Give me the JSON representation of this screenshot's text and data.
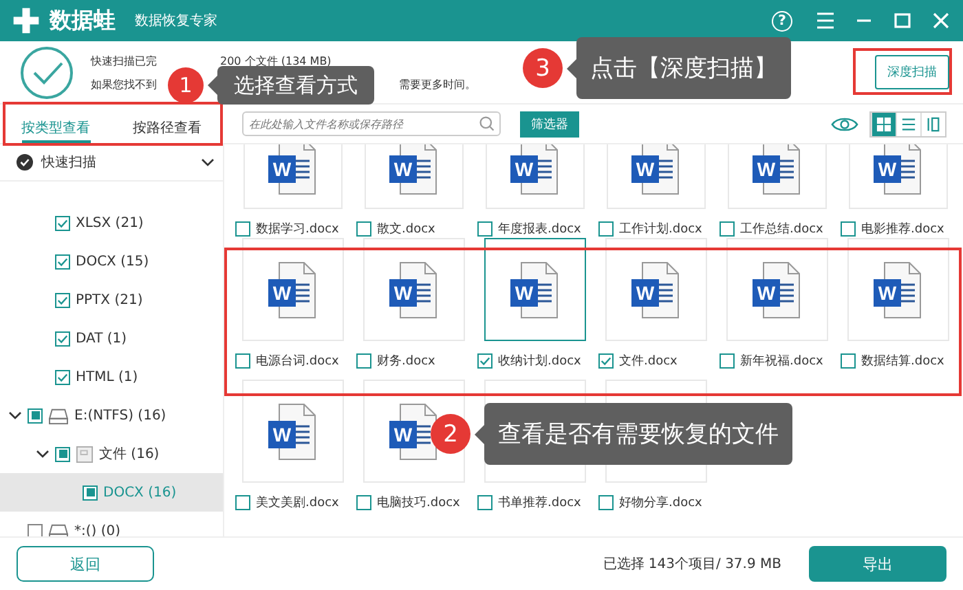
{
  "app": {
    "logo": "数据蛙",
    "subtitle": "数据恢复专家",
    "help": "?"
  },
  "scan_status": {
    "line1_start": "快速扫描已完",
    "line1_end": "200 个文件 (134 MB)",
    "line2_start": "如果您找不到",
    "line2_end": "需要更多时间。"
  },
  "deep_scan_button": "深度扫描",
  "view_tabs": [
    {
      "label": "按类型查看",
      "selected": true
    },
    {
      "label": "按路径查看",
      "selected": false
    }
  ],
  "search": {
    "placeholder": "在此处输入文件名称或保存路径"
  },
  "filter_button": "筛选器",
  "view_modes": [
    {
      "kind": "grid",
      "selected": true
    },
    {
      "kind": "list",
      "selected": false
    },
    {
      "kind": "preview",
      "selected": false
    }
  ],
  "quick_scan": {
    "label": "快速扫描",
    "expanded": true,
    "children": [
      {
        "label": "XLSX (21)",
        "checked": true,
        "selected": false
      },
      {
        "label": "DOCX (15)",
        "checked": true,
        "selected": false
      },
      {
        "label": "PPTX (21)",
        "checked": true,
        "selected": false
      },
      {
        "label": "DAT (1)",
        "checked": true,
        "selected": false
      },
      {
        "label": "HTML (1)",
        "checked": true,
        "selected": false
      }
    ]
  },
  "drives": [
    {
      "kind": "drive",
      "label": "E:(NTFS) (16)",
      "checked": true,
      "partial": true,
      "selected": false,
      "expanded": true,
      "children": [
        {
          "kind": "folder",
          "label": "文件 (16)",
          "checked": true,
          "partial": true,
          "selected": false,
          "expanded": true,
          "children": [
            {
              "label": "DOCX (16)",
              "checked": true,
              "partial": true,
              "selected": true
            }
          ]
        }
      ]
    },
    {
      "kind": "drive",
      "label": "*:() (0)",
      "checked": false,
      "selected": false
    }
  ],
  "file_rows": [
    [
      {
        "name": "数据学习.docx",
        "icon_text": "W",
        "checked": false,
        "selected": false
      },
      {
        "name": "散文.docx",
        "icon_text": "W",
        "checked": false,
        "selected": false
      },
      {
        "name": "年度报表.docx",
        "icon_text": "W",
        "checked": false,
        "selected": false
      },
      {
        "name": "工作计划.docx",
        "icon_text": "W",
        "checked": false,
        "selected": false
      },
      {
        "name": "工作总结.docx",
        "icon_text": "W",
        "checked": false,
        "selected": false
      },
      {
        "name": "电影推荐.docx",
        "icon_text": "W",
        "checked": false,
        "selected": false
      }
    ],
    [
      {
        "name": "电源台词.docx",
        "icon_text": "W",
        "checked": false,
        "selected": false
      },
      {
        "name": "财务.docx",
        "icon_text": "W",
        "checked": false,
        "selected": false
      },
      {
        "name": "收纳计划.docx",
        "icon_text": "W",
        "checked": true,
        "selected": true
      },
      {
        "name": "文件.docx",
        "icon_text": "W",
        "checked": true,
        "selected": false
      },
      {
        "name": "新年祝福.docx",
        "icon_text": "W",
        "checked": false,
        "selected": false
      },
      {
        "name": "数据结算.docx",
        "icon_text": "W",
        "checked": false,
        "selected": false
      }
    ],
    [
      {
        "name": "美文美剧.docx",
        "icon_text": "W",
        "checked": false,
        "selected": false
      },
      {
        "name": "电脑技巧.docx",
        "icon_text": "W",
        "checked": false,
        "selected": false
      },
      {
        "name": "书单推荐.docx",
        "checked": false,
        "selected": false
      },
      {
        "name": "好物分享.docx",
        "checked": false,
        "selected": false
      }
    ]
  ],
  "footer": {
    "back_button": "返回",
    "selection": "已选择 143个项目/ 37.9 MB",
    "export_button": "导出"
  },
  "callouts": [
    {
      "number": "1",
      "text": "选择查看方式"
    },
    {
      "number": "3",
      "text": "点击【深度扫描】"
    },
    {
      "number": "2",
      "text": "查看是否有需要恢复的文件"
    }
  ]
}
